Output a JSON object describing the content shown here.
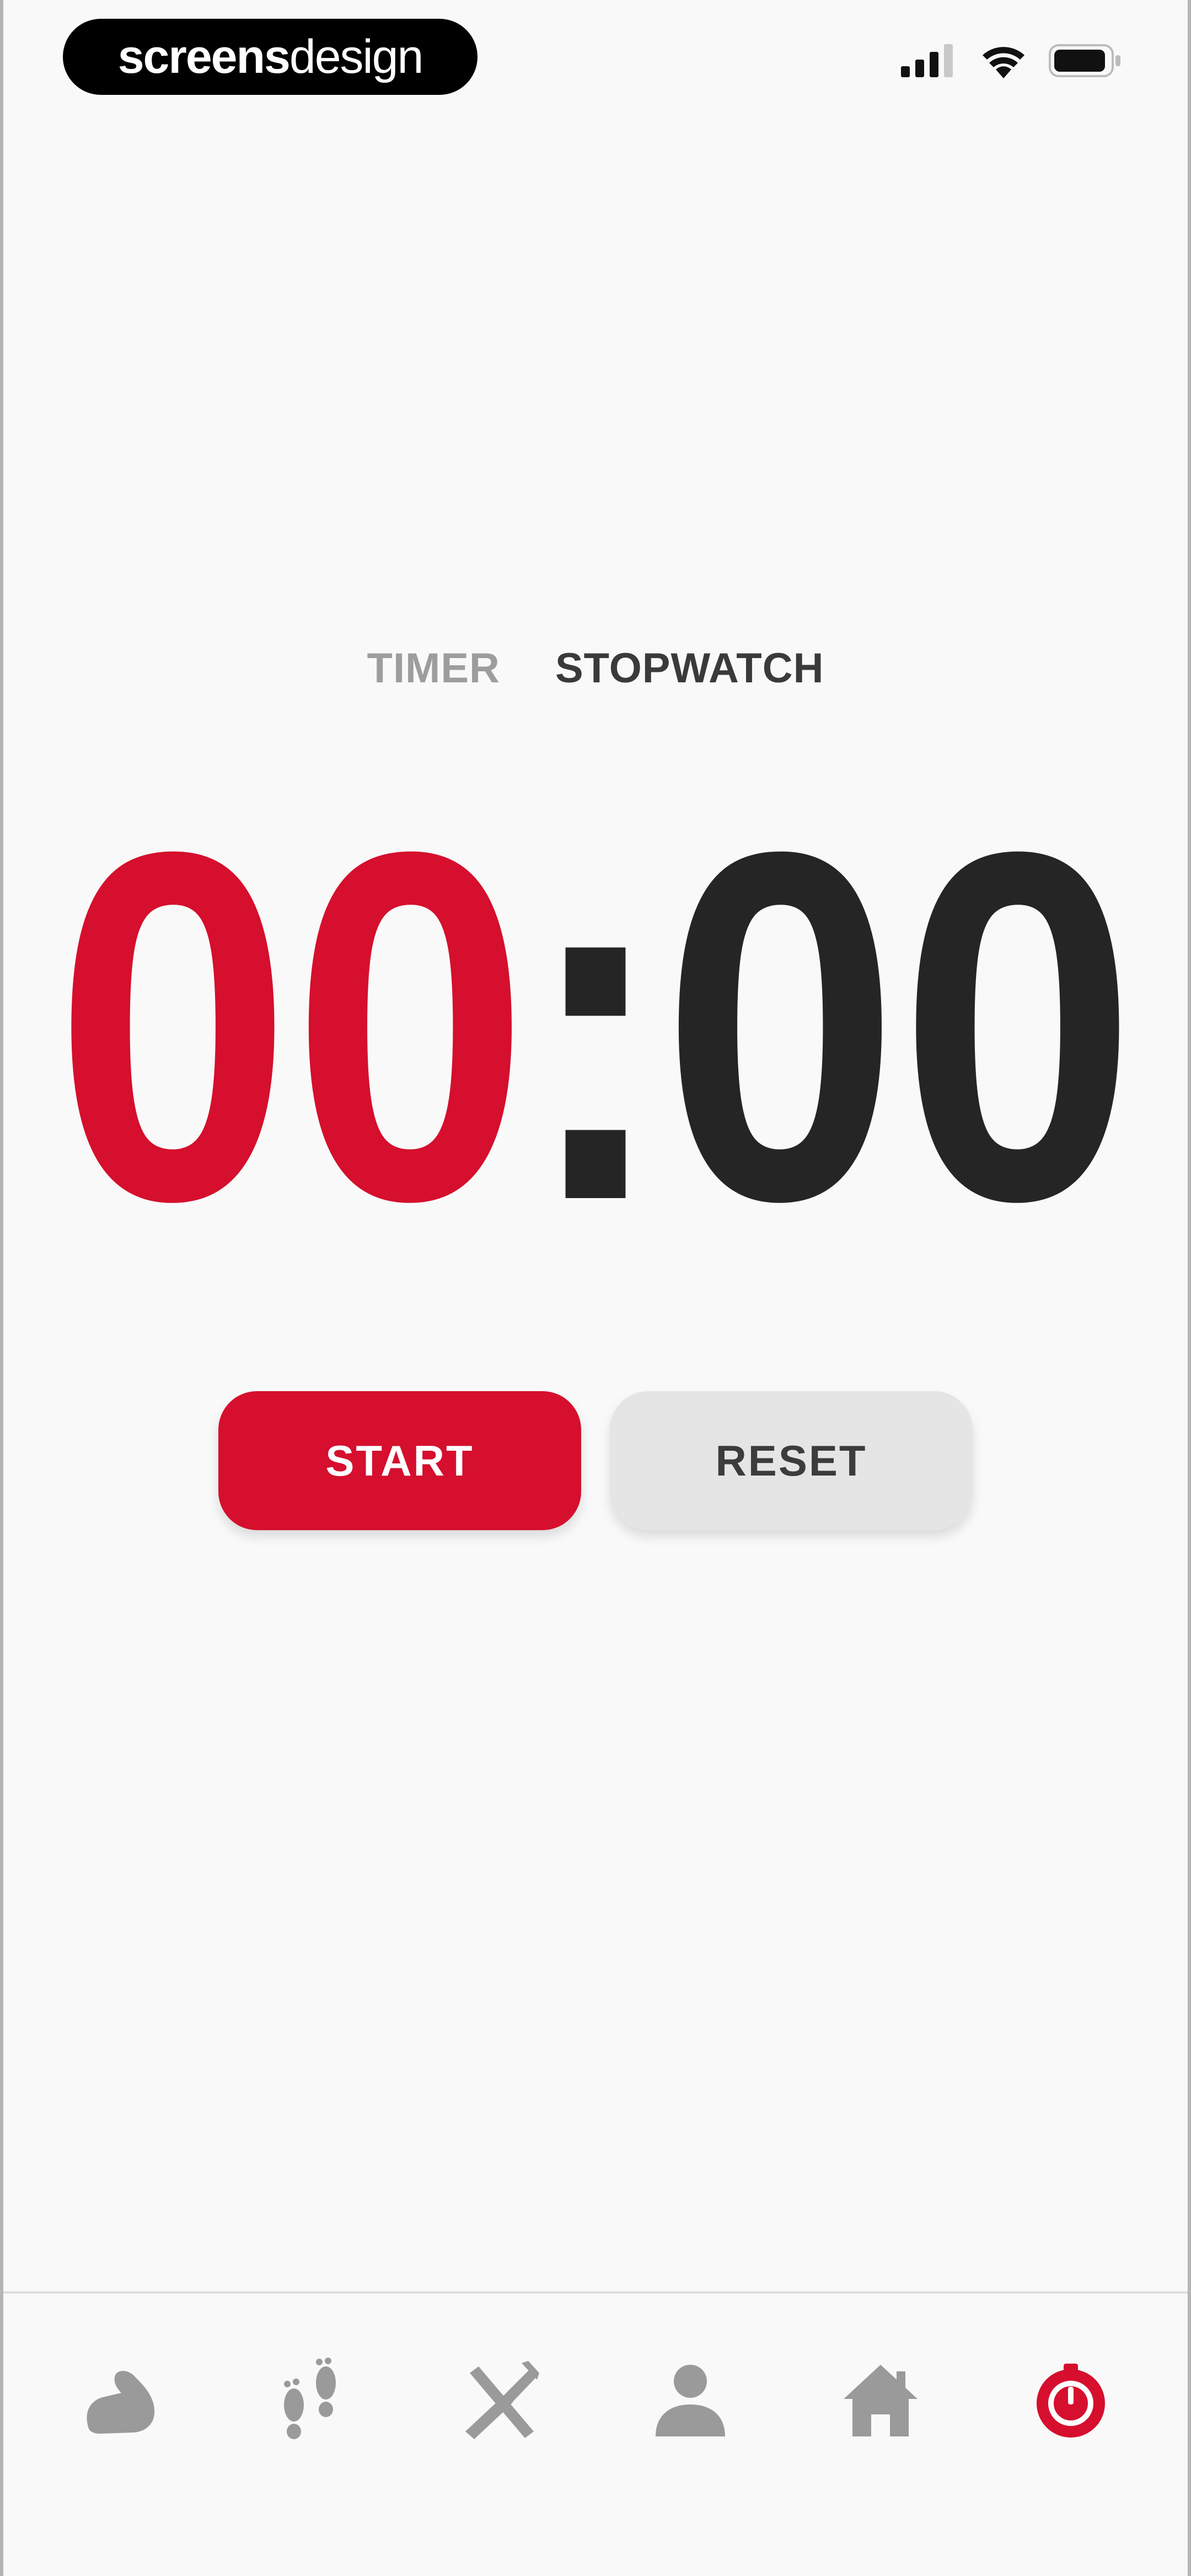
{
  "status_bar": {
    "brand_bold": "screens",
    "brand_light": "design",
    "icons": [
      "cellular-signal-icon",
      "wifi-icon",
      "battery-icon"
    ]
  },
  "mode_tabs": [
    {
      "label": "TIMER",
      "active": false
    },
    {
      "label": "STOPWATCH",
      "active": true
    }
  ],
  "clock": {
    "minutes": "00",
    "separator": ":",
    "seconds": "00"
  },
  "buttons": {
    "start_label": "START",
    "reset_label": "RESET"
  },
  "bottom_nav": {
    "items": [
      {
        "icon": "flexed-arm-icon",
        "active": false
      },
      {
        "icon": "footprints-icon",
        "active": false
      },
      {
        "icon": "fork-knife-icon",
        "active": false
      },
      {
        "icon": "person-icon",
        "active": false
      },
      {
        "icon": "home-icon",
        "active": false
      },
      {
        "icon": "stopwatch-icon",
        "active": true
      }
    ]
  },
  "colors": {
    "accent": "#d50f2d",
    "text_dark": "#252525",
    "inactive_icon": "#9a9a9a",
    "background": "#f9f9f9"
  }
}
